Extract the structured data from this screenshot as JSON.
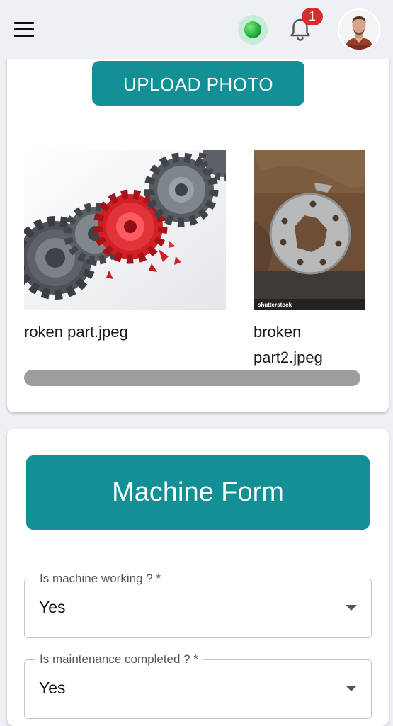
{
  "header": {
    "menu_icon": "hamburger-menu-icon",
    "status_icon": "online-status-dot",
    "status_color": "#2fbd47",
    "bell_icon": "bell-icon",
    "notification_count": "1",
    "badge_color": "#d32f2f",
    "avatar": "user-avatar-photo"
  },
  "upload": {
    "button_label": "UPLOAD PHOTO",
    "photos": [
      {
        "name": "roken part.jpeg",
        "image": "red-and-grey-gears-photo"
      },
      {
        "name": "broken part2.jpeg",
        "image": "broken-metal-gear-plate-photo",
        "watermark": "shutterstock"
      }
    ]
  },
  "form": {
    "title": "Machine Form",
    "fields": [
      {
        "label": "Is machine working ? *",
        "value": "Yes"
      },
      {
        "label": "Is maintenance completed ? *",
        "value": "Yes"
      }
    ]
  },
  "colors": {
    "accent": "#138f96",
    "page_bg": "#eef0f4",
    "card_bg": "#ffffff",
    "scrollbar": "#9e9e9e"
  }
}
